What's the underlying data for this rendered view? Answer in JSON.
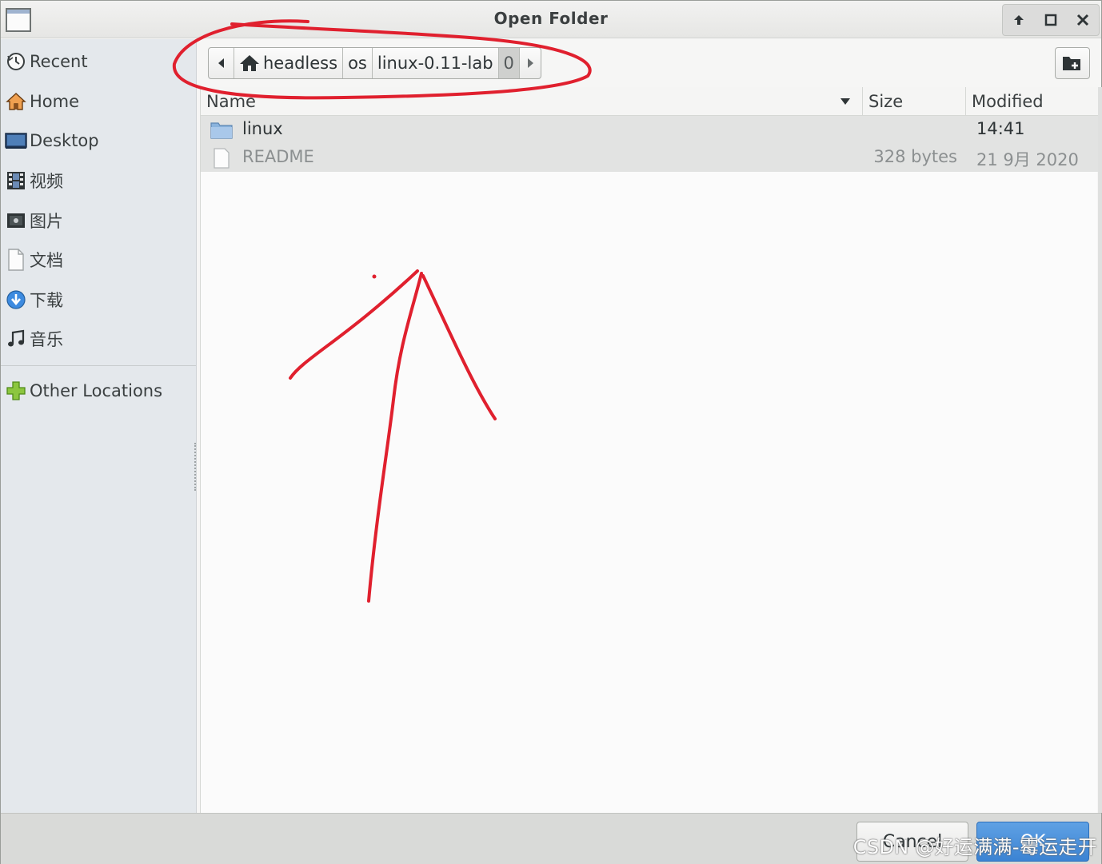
{
  "window": {
    "title": "Open Folder"
  },
  "window_controls": {
    "minimize_glyph": "🡅",
    "maximize_glyph": "□",
    "close_glyph": "✕"
  },
  "sidebar": {
    "items": [
      {
        "label": "Recent",
        "icon": "recent-icon"
      },
      {
        "label": "Home",
        "icon": "home-icon"
      },
      {
        "label": "Desktop",
        "icon": "desktop-icon"
      },
      {
        "label": "视频",
        "icon": "video-icon"
      },
      {
        "label": "图片",
        "icon": "picture-icon"
      },
      {
        "label": "文档",
        "icon": "document-icon"
      },
      {
        "label": "下载",
        "icon": "download-icon"
      },
      {
        "label": "音乐",
        "icon": "music-icon"
      }
    ],
    "other_locations": {
      "label": "Other Locations",
      "icon": "plus-icon"
    }
  },
  "pathbar": {
    "segments": [
      "headless",
      "os",
      "linux-0.11-lab",
      "0"
    ],
    "current_index": 3
  },
  "columns": {
    "name": "Name",
    "size": "Size",
    "modified": "Modified"
  },
  "files": [
    {
      "name": "linux",
      "size": "",
      "modified": "14:41",
      "type": "folder"
    },
    {
      "name": "README",
      "size": "328 bytes",
      "modified": "21 9月 2020",
      "type": "file"
    }
  ],
  "footer": {
    "cancel_label": "Cancel",
    "ok_label": "OK"
  },
  "watermark": "CSDN @好运满满-霉运走开",
  "colors": {
    "annotation": "#e0202e",
    "ok_button": "#3b83d3",
    "sidebar_bg": "#e4e8ec"
  }
}
